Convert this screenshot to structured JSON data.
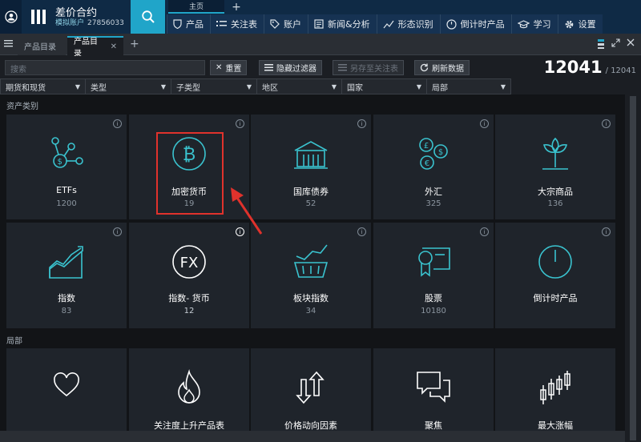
{
  "app": {
    "title": "差价合约",
    "account_type": "模拟账户",
    "account_number": "27856033"
  },
  "topnav": {
    "home_tab": "主页",
    "items": [
      {
        "label": "产品",
        "icon": "shield-icon"
      },
      {
        "label": "关注表",
        "icon": "list-icon"
      },
      {
        "label": "账户",
        "icon": "tag-icon"
      },
      {
        "label": "新闻&分析",
        "icon": "news-icon"
      },
      {
        "label": "形态识别",
        "icon": "pattern-icon"
      },
      {
        "label": "倒计时产品",
        "icon": "clock-icon"
      },
      {
        "label": "学习",
        "icon": "graduation-cap-icon"
      },
      {
        "label": "设置",
        "icon": "gear-icon"
      }
    ]
  },
  "tabs": [
    {
      "label": "产品目录"
    },
    {
      "label": "产品目录",
      "active": true
    }
  ],
  "toolbar": {
    "search_placeholder": "搜索",
    "reset": "重置",
    "hide_filters": "隐藏过滤器",
    "save_watchlist": "另存至关注表",
    "refresh": "刷新数据",
    "count": "12041",
    "total": "/ 12041"
  },
  "filters": [
    "期货和现货",
    "类型",
    "子类型",
    "地区",
    "国家",
    "局部"
  ],
  "sections": {
    "asset_class": "资产类别",
    "local": "局部"
  },
  "tiles_row1": [
    {
      "label": "ETFs",
      "count": "1200"
    },
    {
      "label": "加密货币",
      "count": "19"
    },
    {
      "label": "国库债券",
      "count": "52"
    },
    {
      "label": "外汇",
      "count": "325"
    },
    {
      "label": "大宗商品",
      "count": "136"
    }
  ],
  "tiles_row2": [
    {
      "label": "指数",
      "count": "83"
    },
    {
      "label": "指数- 货币",
      "count": "12"
    },
    {
      "label": "板块指数",
      "count": "34"
    },
    {
      "label": "股票",
      "count": "10180"
    },
    {
      "label": "倒计时产品",
      "count": ""
    }
  ],
  "tiles_row3": [
    {
      "label": ""
    },
    {
      "label": "关注度上升产品表"
    },
    {
      "label": "价格动向因素"
    },
    {
      "label": "聚焦"
    },
    {
      "label": "最大涨幅"
    }
  ],
  "colors": {
    "accent": "#20a5c9",
    "highlight": "#e0322c",
    "icon": "#3ac3cf"
  }
}
